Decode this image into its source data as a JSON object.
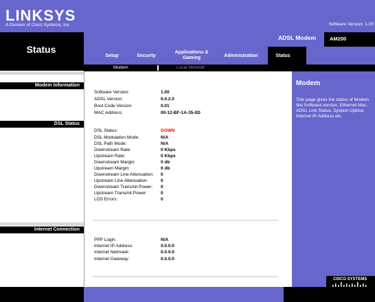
{
  "header": {
    "logo": "LINKSYS",
    "logo_sub": "A Division of Cisco Systems, Inc.",
    "software_version": "Software Version: 1.00"
  },
  "product": {
    "name": "ADSL Modem",
    "model": "AM200"
  },
  "page_title": "Status",
  "tabs": [
    {
      "label": "Setup"
    },
    {
      "label": "Security"
    },
    {
      "label": "Applications &\nGaming"
    },
    {
      "label": "Administration"
    },
    {
      "label": "Status"
    }
  ],
  "subtabs": {
    "modem": "Modem",
    "local_network": "Local Network"
  },
  "sections": {
    "modem_information": "Modem Information",
    "dsl_status": "DSL Status",
    "internet_connection": "Internet Connection"
  },
  "modem_info": [
    {
      "label": "Software Version:",
      "value": "1.00"
    },
    {
      "label": "ADSL Version:",
      "value": "6.0.2.0"
    },
    {
      "label": "Boot Code Version:",
      "value": "0.01"
    },
    {
      "label": "MAC Address:",
      "value": "00-12-BF-1A-35-0D"
    }
  ],
  "dsl_status": [
    {
      "label": "DSL Status:",
      "value": "DOWN"
    },
    {
      "label": "DSL Modulation Mode:",
      "value": "N/A"
    },
    {
      "label": "DSL Path Mode:",
      "value": "N/A"
    },
    {
      "label": "Downstream Rate:",
      "value": "0 Kbps"
    },
    {
      "label": "Upstream Rate:",
      "value": "0 Kbps"
    },
    {
      "label": "Downstream Margin:",
      "value": "0 db"
    },
    {
      "label": "Upstream Margin:",
      "value": "0 db"
    },
    {
      "label": "Downstream Line Attenuation:",
      "value": "0"
    },
    {
      "label": "Upstream Line Attenuation:",
      "value": "0"
    },
    {
      "label": "Downstream Transmit Power:",
      "value": "0"
    },
    {
      "label": "Upstream Transmit Power:",
      "value": "0"
    },
    {
      "label": "LOS Errors:",
      "value": "0"
    }
  ],
  "internet": [
    {
      "label": "PPP Login:",
      "value": "N/A"
    },
    {
      "label": "Internet IP Address:",
      "value": "0.0.0.0"
    },
    {
      "label": "Internet Netmask:",
      "value": "0.0.0.0"
    },
    {
      "label": "Internet Gateway:",
      "value": "0.0.0.0"
    }
  ],
  "help": {
    "title": "Modem",
    "text": "This page gives the status of Modem like Software version, Ethernet Mac, ADSL Link Status, System Uptime, Internet IP Address etc."
  },
  "footer": {
    "cisco": "CISCO SYSTEMS"
  },
  "colors": {
    "brand": "#6666cc",
    "alert": "#ff0000"
  }
}
